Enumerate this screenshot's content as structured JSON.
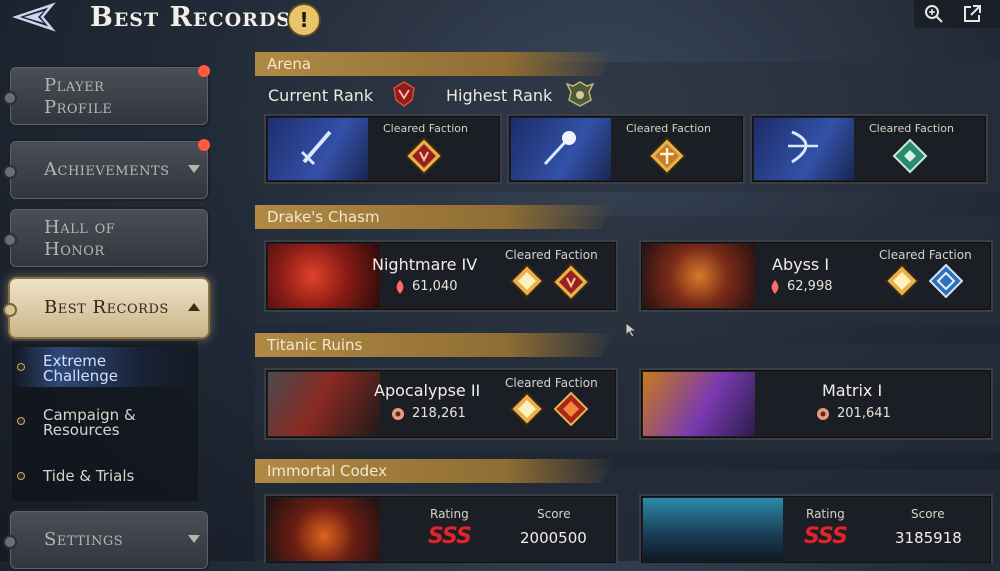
{
  "header": {
    "title": "Best Records",
    "info_symbol": "!"
  },
  "sidebar": {
    "tabs": [
      {
        "label_line1": "Player",
        "label_line2": "Profile"
      },
      {
        "label": "Achievements"
      },
      {
        "label_line1": "Hall of",
        "label_line2": "Honor"
      },
      {
        "label": "Best Records"
      },
      {
        "label": "Settings"
      }
    ],
    "sub_items": [
      {
        "label_line1": "Extreme",
        "label_line2": "Challenge"
      },
      {
        "label_line1": "Campaign &",
        "label_line2": "Resources"
      },
      {
        "label": "Tide & Trials"
      }
    ]
  },
  "arena": {
    "title": "Arena",
    "current_rank_label": "Current Rank",
    "highest_rank_label": "Highest Rank",
    "cards": [
      {
        "cleared_label": "Cleared Faction"
      },
      {
        "cleared_label": "Cleared Faction"
      },
      {
        "cleared_label": "Cleared Faction"
      }
    ]
  },
  "drakes_chasm": {
    "title": "Drake's Chasm",
    "cards": [
      {
        "name": "Nightmare IV",
        "score": "61,040",
        "cleared_label": "Cleared Faction"
      },
      {
        "name": "Abyss I",
        "score": "62,998",
        "cleared_label": "Cleared Faction"
      }
    ]
  },
  "titanic_ruins": {
    "title": "Titanic Ruins",
    "cards": [
      {
        "name": "Apocalypse II",
        "score": "218,261",
        "cleared_label": "Cleared Faction"
      },
      {
        "name": "Matrix I",
        "score": "201,641"
      }
    ]
  },
  "immortal_codex": {
    "title": "Immortal Codex",
    "cards": [
      {
        "rating_label": "Rating",
        "rating_value": "SSS",
        "score_label": "Score",
        "score": "2000500"
      },
      {
        "rating_label": "Rating",
        "rating_value": "SSS",
        "score_label": "Score",
        "score": "3185918"
      }
    ]
  },
  "colors": {
    "accent_gold": "#b08a45",
    "notification": "#ff5a3c",
    "rating_red": "#e0242a"
  }
}
